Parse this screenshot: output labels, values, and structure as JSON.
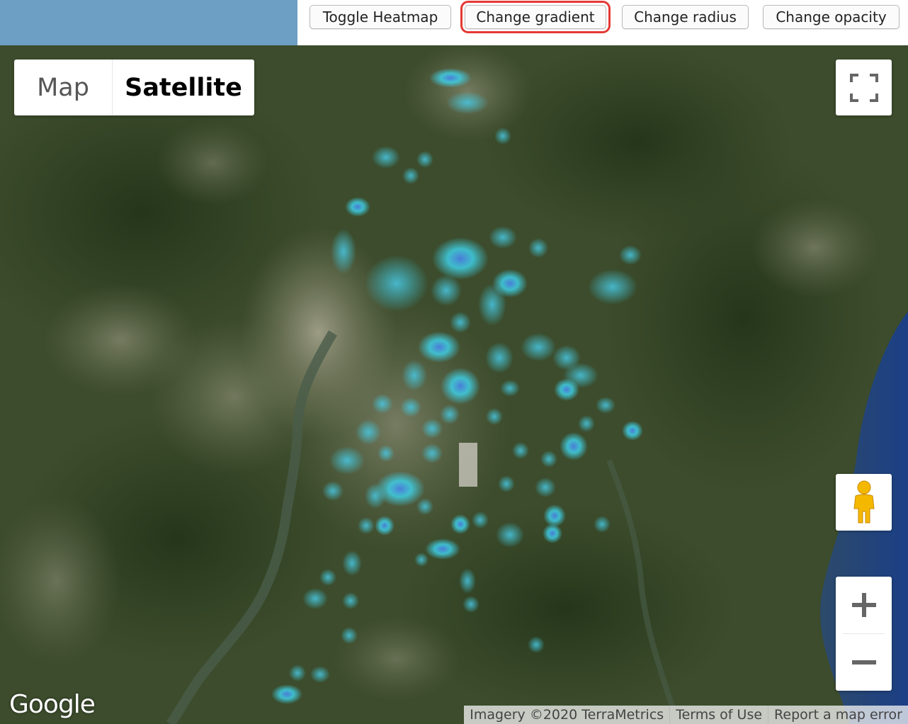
{
  "toolbar": {
    "toggle_heatmap": "Toggle Heatmap",
    "change_gradient": "Change gradient",
    "change_radius": "Change radius",
    "change_opacity": "Change opacity"
  },
  "map_type": {
    "map_label": "Map",
    "satellite_label": "Satellite",
    "selected": "Satellite"
  },
  "controls": {
    "fullscreen_icon": "fullscreen-icon",
    "pegman_icon": "pegman-icon",
    "zoom_in_icon": "plus-icon",
    "zoom_out_icon": "minus-icon"
  },
  "branding": {
    "logo_text": "Google"
  },
  "attribution": {
    "imagery": "Imagery ©2020 TerraMetrics",
    "terms": "Terms of Use",
    "report": "Report a map error"
  },
  "colors": {
    "top_left_panel": "#6d9ec4",
    "heat_cyan": "#3fd0e6",
    "heat_blue": "#4a7fe0",
    "focus_outline": "#e53935"
  }
}
